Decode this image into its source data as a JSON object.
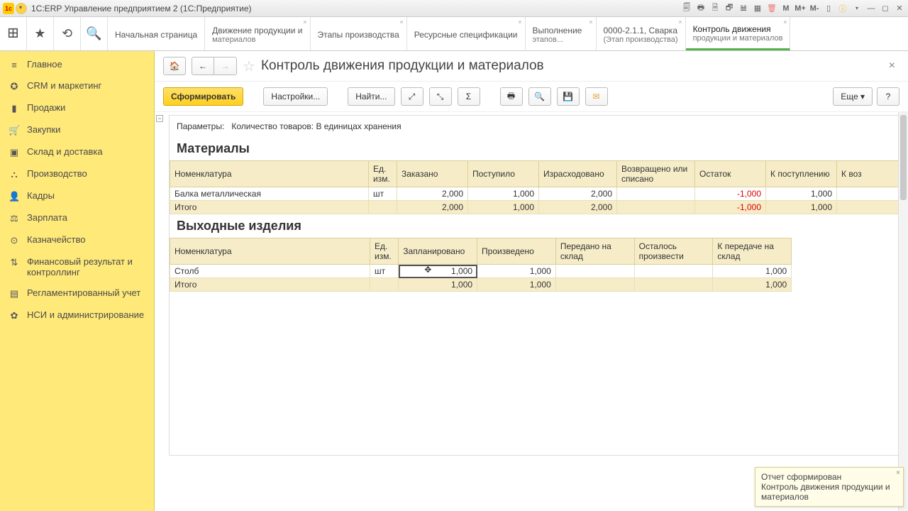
{
  "window": {
    "title": "1С:ERP Управление предприятием 2  (1С:Предприятие)"
  },
  "mbuttons": {
    "m1": "M",
    "m2": "M+",
    "m3": "M-"
  },
  "tabs": [
    {
      "label": "Начальная страница"
    },
    {
      "label": "Движение продукции и",
      "sub": "материалов"
    },
    {
      "label": "Этапы производства"
    },
    {
      "label": "Ресурсные спецификации"
    },
    {
      "label": "Выполнение",
      "sub": "этапов..."
    },
    {
      "label": "0000-2.1.1, Сварка",
      "sub": "(Этап производства)"
    },
    {
      "label": "Контроль движения",
      "sub": "продукции и материалов",
      "active": true
    }
  ],
  "sidebar": [
    {
      "icon": "≡",
      "label": "Главное"
    },
    {
      "icon": "✪",
      "label": "CRM и маркетинг"
    },
    {
      "icon": "▮",
      "label": "Продажи"
    },
    {
      "icon": "🛒",
      "label": "Закупки"
    },
    {
      "icon": "▣",
      "label": "Склад и доставка"
    },
    {
      "icon": "⛬",
      "label": "Производство"
    },
    {
      "icon": "👤",
      "label": "Кадры"
    },
    {
      "icon": "⚖",
      "label": "Зарплата"
    },
    {
      "icon": "⊙",
      "label": "Казначейство"
    },
    {
      "icon": "⇅",
      "label": "Финансовый результат и контроллинг"
    },
    {
      "icon": "▤",
      "label": "Регламентированный учет"
    },
    {
      "icon": "✿",
      "label": "НСИ и администрирование"
    }
  ],
  "page": {
    "title": "Контроль движения продукции и материалов"
  },
  "toolbar": {
    "generate": "Сформировать",
    "settings": "Настройки...",
    "find": "Найти...",
    "more": "Еще",
    "help": "?"
  },
  "report": {
    "params_label": "Параметры:",
    "params_value": "Количество товаров: В единицах хранения",
    "section1": "Материалы",
    "section2": "Выходные изделия",
    "cols1": [
      "Номенклатура",
      "Ед. изм.",
      "Заказано",
      "Поступило",
      "Израсходовано",
      "Возвращено или списано",
      "Остаток",
      "К поступлению",
      "К воз"
    ],
    "rows1": [
      {
        "name": "Балка металлическая",
        "unit": "шт",
        "ordered": "2,000",
        "received": "1,000",
        "spent": "2,000",
        "ret": "",
        "rest": "-1,000",
        "toreceive": "1,000",
        "toret": ""
      }
    ],
    "total1": {
      "label": "Итого",
      "ordered": "2,000",
      "received": "1,000",
      "spent": "2,000",
      "ret": "",
      "rest": "-1,000",
      "toreceive": "1,000",
      "toret": ""
    },
    "cols2": [
      "Номенклатура",
      "Ед. изм.",
      "Запланировано",
      "Произведено",
      "Передано на склад",
      "Осталось произвести",
      "К передаче на склад"
    ],
    "rows2": [
      {
        "name": "Столб",
        "unit": "шт",
        "planned": "1,000",
        "produced": "1,000",
        "transfered": "",
        "left": "",
        "totransfer": "1,000"
      }
    ],
    "total2": {
      "label": "Итого",
      "planned": "1,000",
      "produced": "1,000",
      "transfered": "",
      "left": "",
      "totransfer": "1,000"
    }
  },
  "toast": {
    "title": "Отчет сформирован",
    "body": "Контроль движения продукции и материалов"
  }
}
